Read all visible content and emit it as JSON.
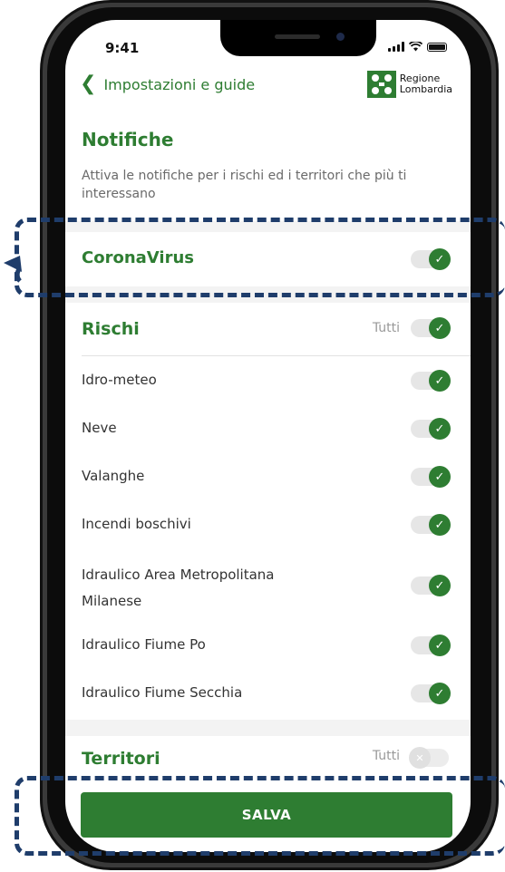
{
  "status_bar": {
    "time": "9:41"
  },
  "header": {
    "back_label": "Impostazioni e guide",
    "logo_line1": "Regione",
    "logo_line2": "Lombardia"
  },
  "page": {
    "title": "Notifiche",
    "description": "Attiva le notifiche per i rischi ed i territori che più ti interessano"
  },
  "coronavirus": {
    "label": "CoronaVirus",
    "enabled": true
  },
  "rischi": {
    "title": "Rischi",
    "all_label": "Tutti",
    "all_enabled": true,
    "items": [
      {
        "label": "Idro-meteo",
        "enabled": true
      },
      {
        "label": "Neve",
        "enabled": true
      },
      {
        "label": "Valanghe",
        "enabled": true
      },
      {
        "label": "Incendi boschivi",
        "enabled": true
      },
      {
        "label": "Idraulico Area Metropolitana Milanese",
        "enabled": true
      },
      {
        "label": "Idraulico Fiume Po",
        "enabled": true
      },
      {
        "label": "Idraulico Fiume Secchia",
        "enabled": true
      }
    ]
  },
  "territori": {
    "title": "Territori",
    "all_label": "Tutti",
    "all_enabled": false
  },
  "save_label": "SALVA",
  "colors": {
    "brand_green": "#2e7d32",
    "annotation_blue": "#1f3d6b"
  }
}
